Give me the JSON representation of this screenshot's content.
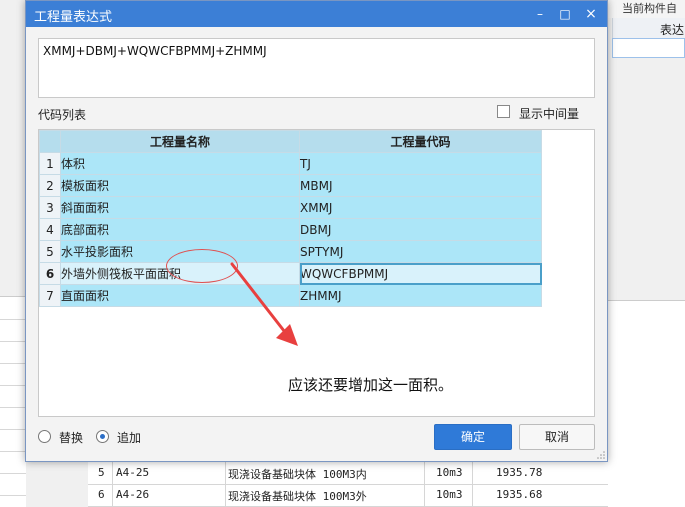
{
  "background": {
    "topbar_text": "当前构件自",
    "column_header": "表达",
    "rows": [
      {
        "index": "5",
        "code": "A4-25",
        "name": "现浇设备基础块体 100M3内",
        "unit": "10m3",
        "price": "1935.78"
      },
      {
        "index": "6",
        "code": "A4-26",
        "name": "现浇设备基础块体 100M3外",
        "unit": "10m3",
        "price": "1935.68"
      }
    ]
  },
  "dialog": {
    "title": "工程量表达式",
    "window_buttons": {
      "minimize": "–",
      "maximize": "□",
      "close": "×"
    },
    "formula": "XMMJ+DBMJ+WQWCFBPMMJ+ZHMMJ",
    "code_list_label": "代码列表",
    "show_intermediate_label": "显示中间量",
    "table": {
      "headers": {
        "name": "工程量名称",
        "code": "工程量代码"
      },
      "rows": [
        {
          "index": "1",
          "name": "体积",
          "code": "TJ"
        },
        {
          "index": "2",
          "name": "模板面积",
          "code": "MBMJ"
        },
        {
          "index": "3",
          "name": "斜面面积",
          "code": "XMMJ"
        },
        {
          "index": "4",
          "name": "底部面积",
          "code": "DBMJ"
        },
        {
          "index": "5",
          "name": "水平投影面积",
          "code": "SPTYMJ"
        },
        {
          "index": "6",
          "name": "外墙外侧筏板平面面积",
          "code": "WQWCFBPMMJ"
        },
        {
          "index": "7",
          "name": "直面面积",
          "code": "ZHMMJ"
        }
      ],
      "selected_index": "6"
    },
    "annotation_text": "应该还要增加这一面积。",
    "annotation_color": "#e05050",
    "radio_replace": "替换",
    "radio_append": "追加",
    "ok_label": "确定",
    "cancel_label": "取消",
    "accent_color": "#2f7ad8"
  }
}
